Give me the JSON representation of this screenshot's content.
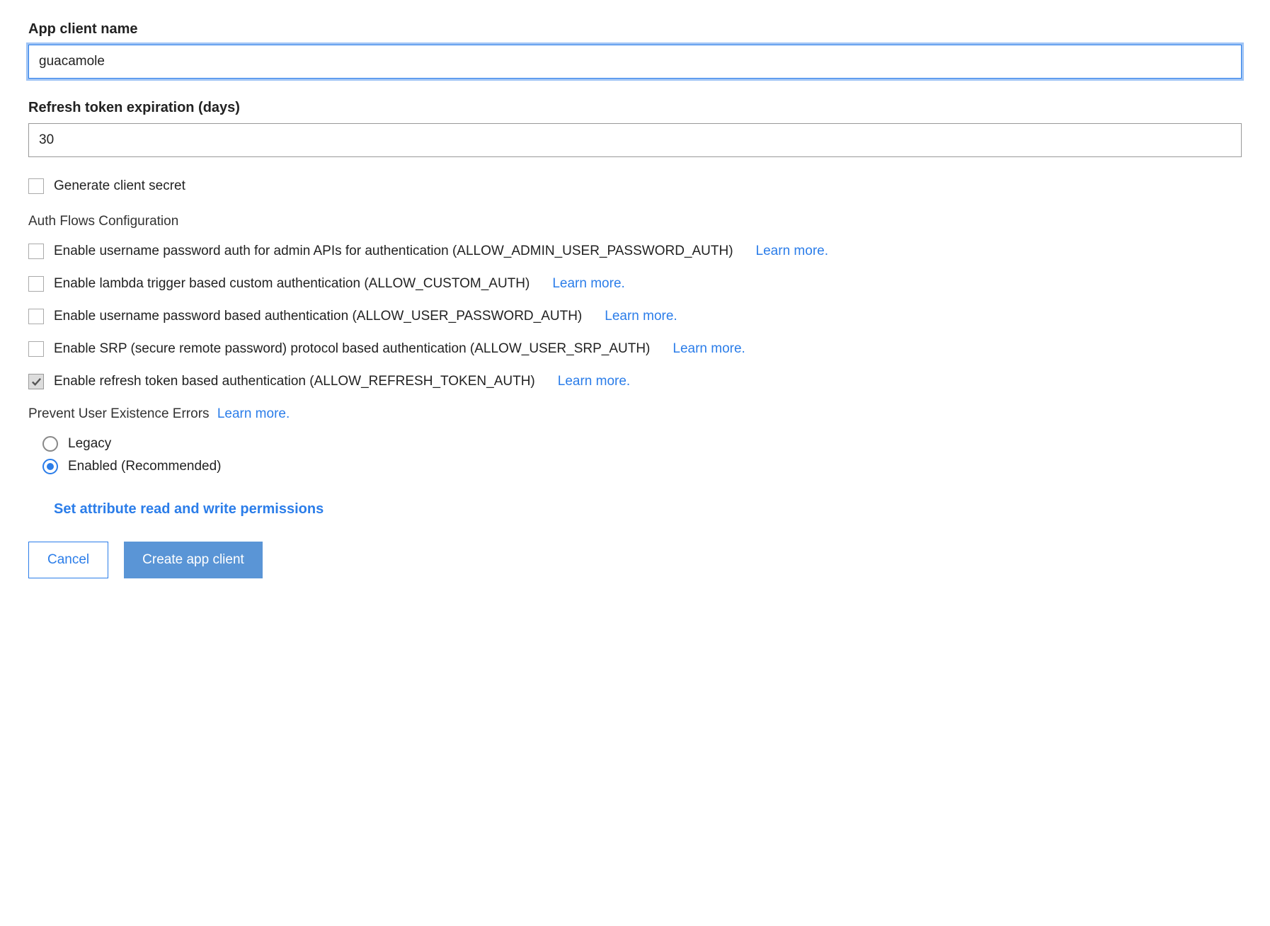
{
  "appClientName": {
    "label": "App client name",
    "value": "guacamole"
  },
  "refreshTokenExpiration": {
    "label": "Refresh token expiration (days)",
    "value": "30"
  },
  "generateClientSecret": {
    "label": "Generate client secret",
    "checked": false
  },
  "authFlows": {
    "title": "Auth Flows Configuration",
    "items": [
      {
        "label": "Enable username password auth for admin APIs for authentication (ALLOW_ADMIN_USER_PASSWORD_AUTH)",
        "checked": false,
        "learnMore": "Learn more."
      },
      {
        "label": "Enable lambda trigger based custom authentication (ALLOW_CUSTOM_AUTH)",
        "checked": false,
        "learnMore": "Learn more."
      },
      {
        "label": "Enable username password based authentication (ALLOW_USER_PASSWORD_AUTH)",
        "checked": false,
        "learnMore": "Learn more."
      },
      {
        "label": "Enable SRP (secure remote password) protocol based authentication (ALLOW_USER_SRP_AUTH)",
        "checked": false,
        "learnMore": "Learn more."
      },
      {
        "label": "Enable refresh token based authentication (ALLOW_REFRESH_TOKEN_AUTH)",
        "checked": true,
        "learnMore": "Learn more."
      }
    ]
  },
  "preventUserExistence": {
    "title": "Prevent User Existence Errors",
    "learnMore": "Learn more.",
    "options": [
      {
        "label": "Legacy",
        "selected": false
      },
      {
        "label": "Enabled (Recommended)",
        "selected": true
      }
    ]
  },
  "permissionsLink": "Set attribute read and write permissions",
  "buttons": {
    "cancel": "Cancel",
    "create": "Create app client"
  }
}
